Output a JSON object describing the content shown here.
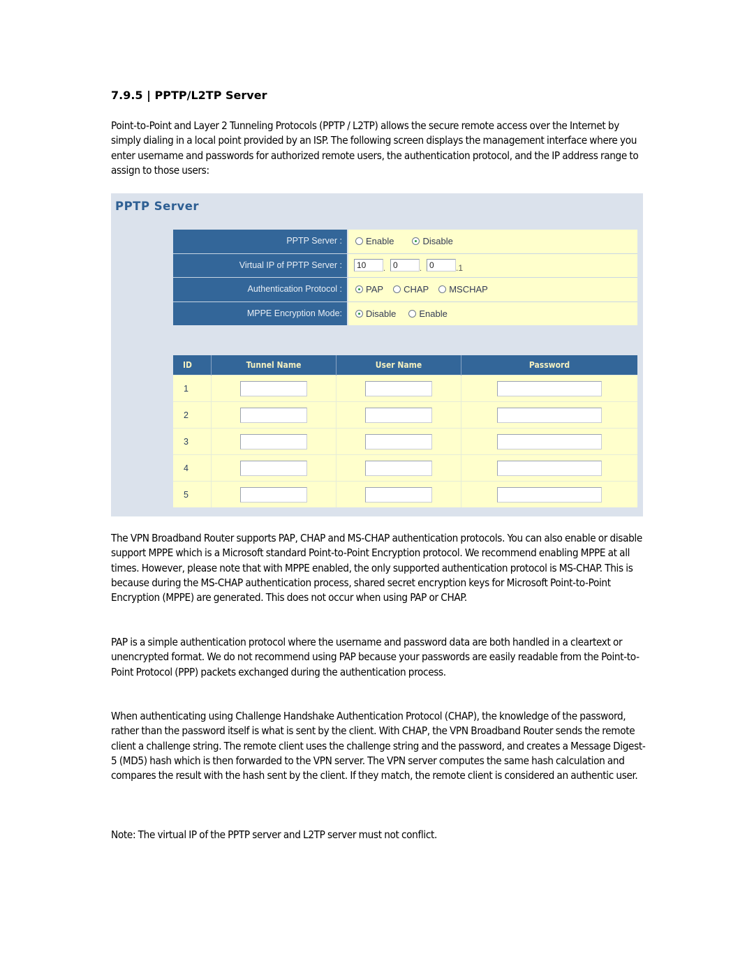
{
  "heading": "7.9.5 | PPTP/L2TP Server",
  "paragraphs": {
    "intro": "Point-to-Point and Layer 2 Tunneling Protocols (PPTP / L2TP) allows the secure remote access over the Internet by simply dialing in a local point provided by an ISP. The following screen displays the management interface where you enter username and passwords for authorized remote users, the authentication protocol, and the IP address range to assign to those users:",
    "protocols": "The VPN Broadband Router supports PAP, CHAP and MS-CHAP authentication protocols. You can also enable or disable support MPPE which is a Microsoft standard Point-to-Point Encryption protocol. We recommend enabling MPPE at all times. However, please note that with MPPE enabled, the only supported authentication protocol is MS-CHAP. This is because during the MS-CHAP authentication process, shared secret encryption keys for Microsoft Point-to-Point Encryption (MPPE) are generated. This does not occur when using PAP or CHAP.",
    "pap": "PAP is a simple authentication protocol where the username and password data are both handled in a cleartext or unencrypted format. We do not recommend using PAP because your passwords are easily readable from the Point-to-Point Protocol (PPP) packets exchanged during the authentication process.",
    "chap": "When authenticating using Challenge Handshake Authentication Protocol (CHAP), the knowledge of the password, rather than the password itself is what is sent by the client. With CHAP, the VPN Broadband Router sends the remote client a challenge string. The remote client uses the challenge string and the password, and creates a Message Digest-5 (MD5) hash which is then forwarded to the VPN server. The VPN server computes the same hash calculation and compares the result with the hash sent by the client. If they match, the remote client is considered an authentic user.",
    "note": "Note: The virtual IP of the PPTP server and L2TP server must not conflict."
  },
  "panel": {
    "title": "PPTP Server",
    "settings": {
      "server": {
        "label": "PPTP Server :",
        "options": [
          "Enable",
          "Disable"
        ],
        "selected": "Disable"
      },
      "virtual_ip": {
        "label": "Virtual IP of PPTP Server :",
        "octets": [
          "10",
          "0",
          "0"
        ],
        "last_octet": ".1"
      },
      "auth": {
        "label": "Authentication Protocol :",
        "options": [
          "PAP",
          "CHAP",
          "MSCHAP"
        ],
        "selected": "PAP"
      },
      "mppe": {
        "label": "MPPE Encryption Mode:",
        "options": [
          "Disable",
          "Enable"
        ],
        "selected": "Disable"
      }
    },
    "users_table": {
      "columns": [
        "ID",
        "Tunnel Name",
        "User Name",
        "Password"
      ],
      "rows": [
        {
          "id": "1",
          "tunnel_name": "",
          "user_name": "",
          "password": ""
        },
        {
          "id": "2",
          "tunnel_name": "",
          "user_name": "",
          "password": ""
        },
        {
          "id": "3",
          "tunnel_name": "",
          "user_name": "",
          "password": ""
        },
        {
          "id": "4",
          "tunnel_name": "",
          "user_name": "",
          "password": ""
        },
        {
          "id": "5",
          "tunnel_name": "",
          "user_name": "",
          "password": ""
        }
      ]
    }
  },
  "colors": {
    "header_blue": "#336699",
    "row_yellow": "#ffffcc",
    "panel_bg": "#dbe2ec",
    "title_blue": "#2e5f93"
  }
}
